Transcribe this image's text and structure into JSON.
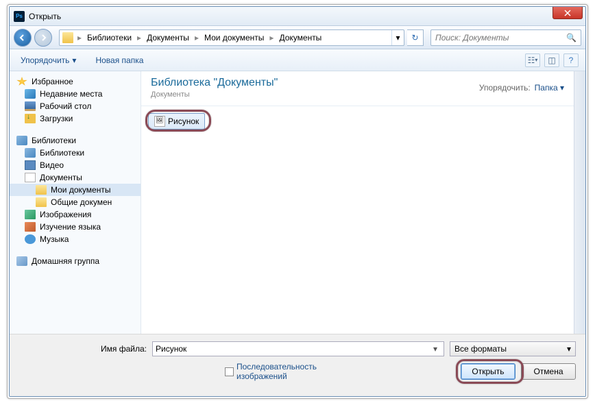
{
  "title": "Открыть",
  "closeBtn": "✕",
  "nav": {
    "breadcrumb": [
      "Библиотеки",
      "Документы",
      "Мои документы",
      "Документы"
    ],
    "searchPlaceholder": "Поиск: Документы"
  },
  "toolbar": {
    "organize": "Упорядочить",
    "newFolder": "Новая папка"
  },
  "sidebar": {
    "favorites": {
      "label": "Избранное",
      "items": [
        "Недавние места",
        "Рабочий стол",
        "Загрузки"
      ]
    },
    "libraries": {
      "label": "Библиотеки",
      "items": [
        "Библиотеки",
        "Видео",
        "Документы"
      ],
      "docChildren": [
        "Мои документы",
        "Общие докумен"
      ],
      "tail": [
        "Изображения",
        "Изучение языка",
        "Музыка"
      ]
    },
    "homegroup": {
      "label": "Домашняя группа"
    }
  },
  "main": {
    "libTitle": "Библиотека \"Документы\"",
    "libSub": "Документы",
    "arrangeLabel": "Упорядочить:",
    "arrangeValue": "Папка",
    "fileItem": "Рисунок"
  },
  "bottom": {
    "fileNameLabel": "Имя файла:",
    "fileNameValue": "Рисунок",
    "formatValue": "Все форматы",
    "sequenceLabel": "Последовательность изображений",
    "openBtn": "Открыть",
    "cancelBtn": "Отмена"
  }
}
